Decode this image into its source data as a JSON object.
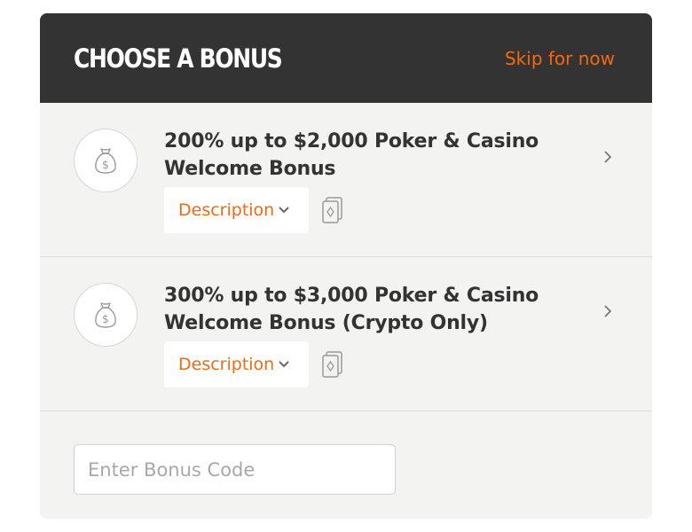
{
  "header": {
    "title": "CHOOSE A BONUS",
    "skip_label": "Skip for now"
  },
  "bonuses": [
    {
      "title": "200% up to $2,000 Poker & Casino Welcome Bonus",
      "description_label": "Description",
      "icon": "money-bag-icon"
    },
    {
      "title": "300% up to $3,000 Poker & Casino Welcome Bonus (Crypto Only)",
      "description_label": "Description",
      "icon": "money-bag-icon"
    }
  ],
  "bonus_code": {
    "placeholder": "Enter Bonus Code",
    "value": ""
  },
  "colors": {
    "header_bg": "#333333",
    "accent": "#f26a10",
    "panel_bg": "#f3f3f1"
  }
}
